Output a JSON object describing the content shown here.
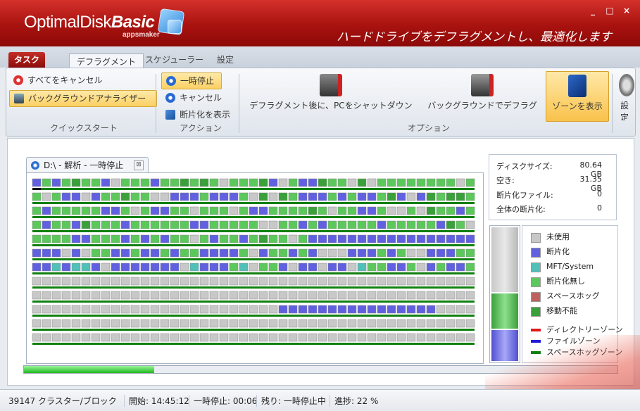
{
  "app": {
    "logo_text": "OptimalDisk",
    "logo_bold": "Basic",
    "logo_sub": "appsmaker",
    "tagline": "ハードドライブをデフラグメントし、最適化します",
    "window_buttons": [
      "_",
      "□",
      "×"
    ]
  },
  "tabs": {
    "task": "タスク",
    "defrag": "デフラグメント",
    "scheduler": "スケジューラー",
    "settings": "設定"
  },
  "ribbon": {
    "quickstart": {
      "cancel_all": "すべてをキャンセル",
      "bg_analyzer": "バックグラウンドアナライザー",
      "label": "クイックスタート"
    },
    "action": {
      "pause": "一時停止",
      "cancel": "キャンセル",
      "show_frag": "断片化を表示",
      "label": "アクション"
    },
    "options": {
      "shutdown_after": "デフラグメント後に、PCをシャットダウン",
      "bg_defrag": "バックグラウンドでデフラグ",
      "show_zones": "ゾーンを表示",
      "settings_cut": "設定",
      "label": "オプション"
    }
  },
  "disk_tab": {
    "label": "D:\\ - 解析 - 一時停止",
    "close": "⊠"
  },
  "disk_info": {
    "size_label": "ディスクサイズ:",
    "size_value": "80.64 GB",
    "free_label": "空き:",
    "free_value": "31.35 GB",
    "fragfiles_label": "断片化ファイル:",
    "fragfiles_value": "0",
    "totalfrag_label": "全体の断片化:",
    "totalfrag_value": "0"
  },
  "legend": {
    "unused": "未使用",
    "fragmented": "断片化",
    "mft": "MFT/System",
    "not_fragmented": "断片化無し",
    "space_hog": "スペースホッグ",
    "unmovable": "移動不能",
    "dir_zone": "ディレクトリーゾーン",
    "file_zone": "ファイルゾーン",
    "hog_zone": "スペースホッグゾーン"
  },
  "colors": {
    "unused": "#c8c8c8",
    "fragmented": "#6060e0",
    "mft": "#50c0b8",
    "not_fragmented": "#5cc85c",
    "space_hog": "#c06060",
    "unmovable": "#3aa03a",
    "dir_zone": "#e01818",
    "file_zone": "#1c1cd8",
    "hog_zone": "#108010"
  },
  "progress": {
    "fraction": 0.22
  },
  "status": {
    "clusters": "39147 クラスター/ブロック",
    "start": "開始: 14:45:12",
    "paused": "一時停止: 00:06",
    "remaining": "残り: 一時停止中",
    "progress": "進捗: 22 %"
  }
}
